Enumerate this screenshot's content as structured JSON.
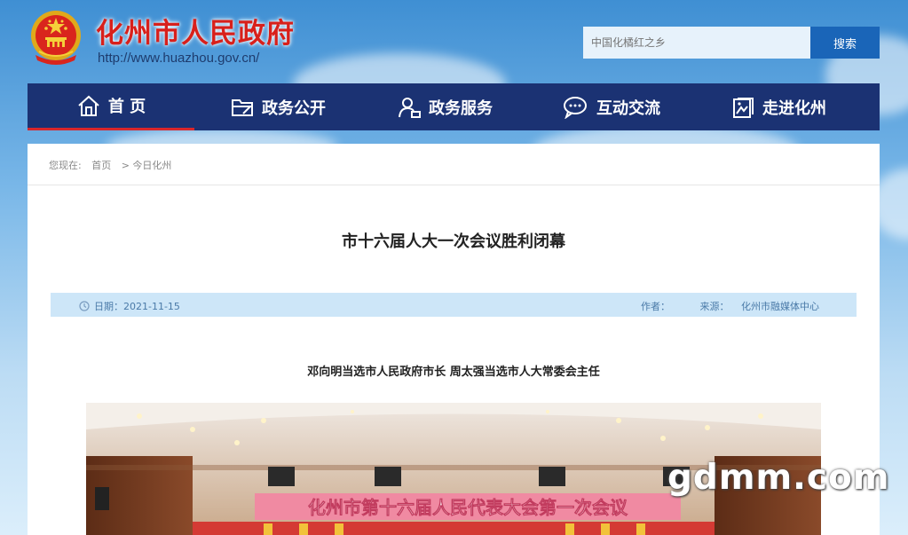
{
  "site": {
    "title": "化州市人民政府",
    "url": "http://www.huazhou.gov.cn/"
  },
  "search": {
    "placeholder": "中国化橘红之乡",
    "button_label": "搜索"
  },
  "nav": {
    "items": [
      {
        "label": "首 页",
        "icon": "home-icon",
        "active": true
      },
      {
        "label": "政务公开",
        "icon": "folder-icon",
        "active": false
      },
      {
        "label": "政务服务",
        "icon": "user-service-icon",
        "active": false
      },
      {
        "label": "互动交流",
        "icon": "chat-icon",
        "active": false
      },
      {
        "label": "走进化州",
        "icon": "picture-icon",
        "active": false
      }
    ]
  },
  "breadcrumb": {
    "prefix": "您现在:",
    "home": "首页",
    "current": "> 今日化州"
  },
  "article": {
    "title": "市十六届人大一次会议胜利闭幕",
    "date": "日期：2021-11-15",
    "author_label": "作者：",
    "source_label": "来源：",
    "source": "化州市融媒体中心",
    "subtitle": "邓向明当选市人民政府市长  周太强当选市人大常委会主任",
    "photo_banner": "化州市第十六届人民代表大会第一次会议"
  },
  "watermark": "gdmm.com",
  "colors": {
    "nav_bg": "#1b3273",
    "nav_active": "#d9272c",
    "search_button": "#1a65b8",
    "meta_bar": "#cde6f8",
    "site_title": "#d8201b"
  }
}
